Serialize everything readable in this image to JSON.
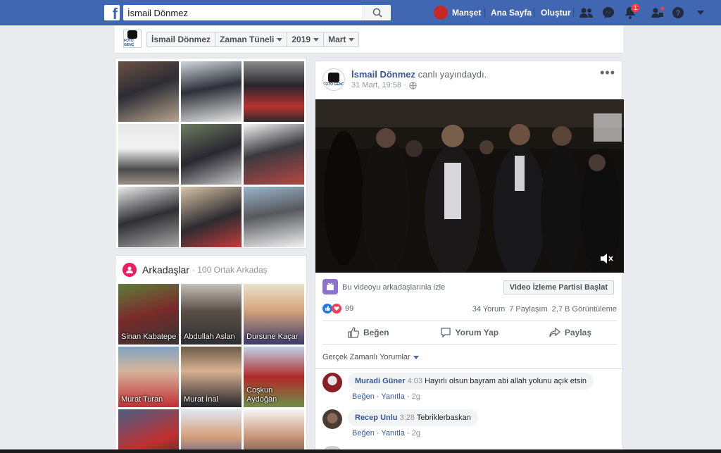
{
  "topbar": {
    "search_value": "İsmail Dönmez",
    "user_name": "Manşet",
    "home": "Ana Sayfa",
    "create": "Oluştur",
    "notifications_badge": "1",
    "colors": {
      "bar": "#4267b2"
    }
  },
  "header": {
    "breadcrumbs": [
      "İsmail Dönmez",
      "Zaman Tüneli",
      "2019",
      "Mart"
    ],
    "logo_text": "FOTO GENÇ"
  },
  "friends": {
    "title": "Arkadaşlar",
    "subtitle": "· 100 Ortak Arkadaş",
    "items": [
      {
        "name": "Sinan Kabatepe"
      },
      {
        "name": "Abdullah Aslan"
      },
      {
        "name": "Dursune Kaçar"
      },
      {
        "name": "Murat Turan"
      },
      {
        "name": "Murat İnal"
      },
      {
        "name": "Coşkun\nAydoğan"
      },
      {
        "name": ""
      },
      {
        "name": ""
      },
      {
        "name": ""
      }
    ]
  },
  "post": {
    "author": "İsmail Dönmez",
    "action": " canlı yayındaydı.",
    "time": "31 Mart, 19:58 ·",
    "logo_text": "FOTO GENÇ",
    "party_text": "Bu videoyu arkadaşlarınla izle",
    "party_button": "Video İzleme Partisi Başlat",
    "reactions_count": "99",
    "comments_count": "34 Yorum",
    "shares_count": "7 Paylaşım",
    "views_count": "2,7 B Görüntüleme",
    "like_label": "Beğen",
    "comment_label": "Yorum Yap",
    "share_label": "Paylaş",
    "sort_label": "Gerçek Zamanlı Yorumlar"
  },
  "comments": [
    {
      "name": "Muradi Güner",
      "time": "4:03",
      "text": "Hayırlı olsun bayram abi allah yolunu açık etsin",
      "like": "Beğen",
      "reply": "Yanıtla",
      "age": "2g"
    },
    {
      "name": "Recep Unlu",
      "time": "3:28",
      "text": "Tebriklerbaskan",
      "like": "Beğen",
      "reply": "Yanıtla",
      "age": "2g"
    }
  ]
}
